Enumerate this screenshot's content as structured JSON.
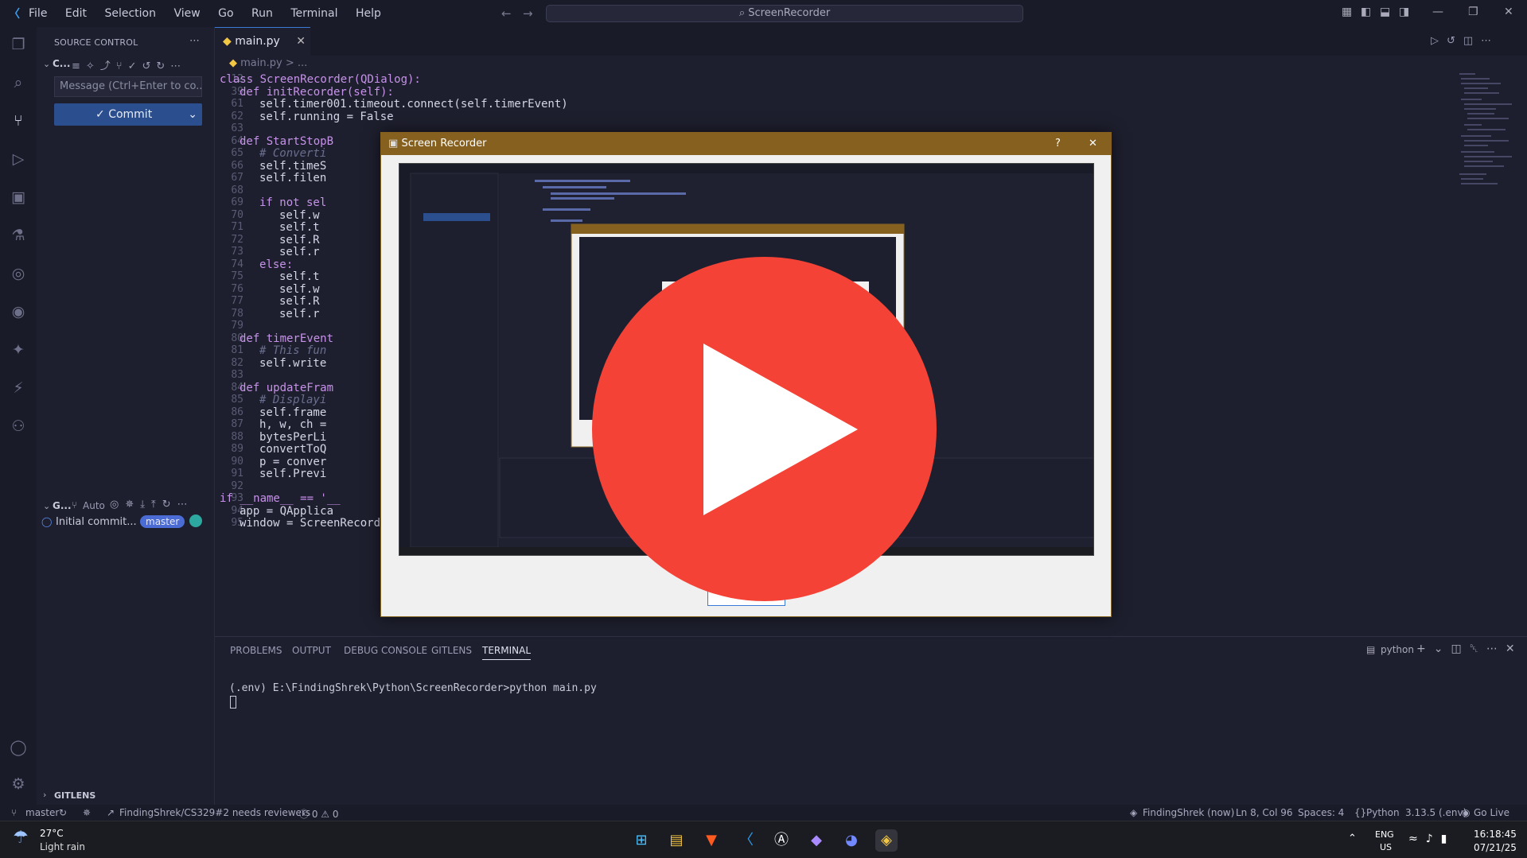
{
  "titlebar": {
    "menu": [
      "File",
      "Edit",
      "Selection",
      "View",
      "Go",
      "Run",
      "Terminal",
      "Help"
    ],
    "command_center": "ScreenRecorder"
  },
  "sidebar": {
    "title": "SOURCE CONTROL",
    "repo_label": "C...",
    "message_placeholder": "Message (Ctrl+Enter to co...",
    "commit_label": "Commit",
    "graph_label": "G...",
    "graph_auto": "Auto",
    "graph_commit": "Initial commit...",
    "graph_branch": "master",
    "gitlens_label": "GITLENS"
  },
  "editor": {
    "tab_label": "main.py",
    "breadcrumb": "main.py > ...",
    "lines": [
      {
        "n": "12",
        "indent": 0,
        "text": "class ScreenRecorder(QDialog):"
      },
      {
        "n": "39",
        "indent": 1,
        "text": "def initRecorder(self):"
      },
      {
        "n": "61",
        "indent": 2,
        "text": "self.timer001.timeout.connect(self.timerEvent)"
      },
      {
        "n": "62",
        "indent": 2,
        "text": "self.running = False"
      },
      {
        "n": "63",
        "indent": 0,
        "text": ""
      },
      {
        "n": "64",
        "indent": 1,
        "text": "def StartStopB"
      },
      {
        "n": "65",
        "indent": 2,
        "text": "# Converti"
      },
      {
        "n": "66",
        "indent": 2,
        "text": "self.timeS"
      },
      {
        "n": "67",
        "indent": 2,
        "text": "self.filen"
      },
      {
        "n": "68",
        "indent": 0,
        "text": ""
      },
      {
        "n": "69",
        "indent": 2,
        "text": "if not sel"
      },
      {
        "n": "70",
        "indent": 3,
        "text": "self.w"
      },
      {
        "n": "71",
        "indent": 3,
        "text": "self.t"
      },
      {
        "n": "72",
        "indent": 3,
        "text": "self.R"
      },
      {
        "n": "73",
        "indent": 3,
        "text": "self.r"
      },
      {
        "n": "74",
        "indent": 2,
        "text": "else:"
      },
      {
        "n": "75",
        "indent": 3,
        "text": "self.t"
      },
      {
        "n": "76",
        "indent": 3,
        "text": "self.w"
      },
      {
        "n": "77",
        "indent": 3,
        "text": "self.R"
      },
      {
        "n": "78",
        "indent": 3,
        "text": "self.r"
      },
      {
        "n": "79",
        "indent": 0,
        "text": ""
      },
      {
        "n": "80",
        "indent": 1,
        "text": "def timerEvent"
      },
      {
        "n": "81",
        "indent": 2,
        "text": "# This fun"
      },
      {
        "n": "82",
        "indent": 2,
        "text": "self.write"
      },
      {
        "n": "83",
        "indent": 0,
        "text": ""
      },
      {
        "n": "84",
        "indent": 1,
        "text": "def updateFram"
      },
      {
        "n": "85",
        "indent": 2,
        "text": "# Displayi"
      },
      {
        "n": "86",
        "indent": 2,
        "text": "self.frame"
      },
      {
        "n": "87",
        "indent": 2,
        "text": "h, w, ch ="
      },
      {
        "n": "88",
        "indent": 2,
        "text": "bytesPerLi"
      },
      {
        "n": "89",
        "indent": 2,
        "text": "convertToQ"
      },
      {
        "n": "90",
        "indent": 2,
        "text": "p = conver"
      },
      {
        "n": "91",
        "indent": 2,
        "text": "self.Previ"
      },
      {
        "n": "92",
        "indent": 0,
        "text": ""
      },
      {
        "n": "93",
        "indent": 0,
        "text": "if __name__ == '__"
      },
      {
        "n": "94",
        "indent": 1,
        "text": "app = QApplica"
      },
      {
        "n": "95",
        "indent": 1,
        "text": "window = ScreenRecorder()"
      }
    ]
  },
  "panel": {
    "tabs": [
      "PROBLEMS",
      "OUTPUT",
      "DEBUG CONSOLE",
      "GITLENS",
      "TERMINAL"
    ],
    "active_tab": "TERMINAL",
    "terminal_name": "python",
    "terminal_line": "(.env) E:\\FindingShrek\\Python\\ScreenRecorder>python main.py"
  },
  "statusbar": {
    "branch": "master",
    "pr": "FindingShrek/CS329#2 needs reviewers",
    "problems": "ⓧ 0 ⚠ 0",
    "blame": "FindingShrek (now)",
    "position": "Ln 8, Col 96",
    "spaces": "Spaces: 4",
    "language": "Python",
    "interpreter": "3.13.5 (.env)",
    "golive": "Go Live"
  },
  "dialog": {
    "title": "Screen Recorder",
    "help": "?",
    "close": "✕"
  },
  "taskbar": {
    "weather_temp": "27°C",
    "weather_desc": "Light rain",
    "lang_top": "ENG",
    "lang_bottom": "US",
    "time": "16:18:45",
    "date": "07/21/25"
  },
  "colors": {
    "play_button": "#f44336",
    "dialog_titlebar": "#86601f",
    "commit_button": "#2b4f8e"
  }
}
